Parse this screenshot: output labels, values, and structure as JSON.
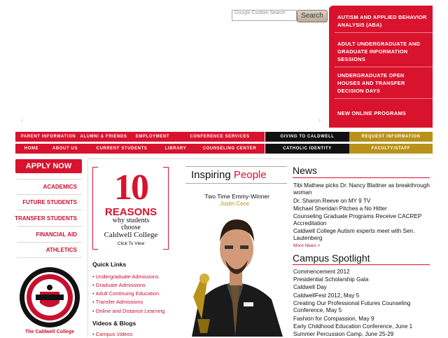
{
  "search": {
    "placeholder": "Custom Search",
    "brand": "Google",
    "button_label": "Search"
  },
  "promo": {
    "items": [
      "AUTISM AND APPLIED BEHAVIOR ANALYSIS (ABA)",
      "ADULT UNDERGRADUATE AND GRADUATE INFORMATION SESSIONS",
      "UNDERGRADUATE OPEN HOUSES AND TRANSFER DECISION DAYS",
      "NEW ONLINE PROGRAMS"
    ]
  },
  "nav_top": [
    "PARENT INFORMATION",
    "ALUMNI & FRIENDS",
    "EMPLOYMENT",
    "CONFERENCE SERVICES",
    "GIVING TO CALDWELL",
    "REQUEST INFORMATION"
  ],
  "nav_bottom": [
    "HOME",
    "ABOUT US",
    "CURRENT STUDENTS",
    "LIBRARY",
    "COUNSELING CENTER",
    "CATHOLIC IDENTITY",
    "FACULTY/STAFF"
  ],
  "sidebar": {
    "apply_label": "APPLY NOW",
    "links": [
      "ACADEMICS",
      "FUTURE STUDENTS",
      "TRANSFER STUDENTS",
      "FINANCIAL AID",
      "ATHLETICS"
    ],
    "seal_caption": "The Caldwell College"
  },
  "reasons": {
    "number": "10",
    "word": "REASONS",
    "line1": "why students",
    "line2": "choose",
    "line3": "Caldwell College",
    "cta": "Click To View"
  },
  "quick_links": {
    "heading": "Quick Links",
    "items": [
      "Undergraduate Admissions",
      "Graduate Admissions",
      "Adult Continuing Education",
      "Transfer Admissions",
      "Online and Distance Learning"
    ]
  },
  "videos": {
    "heading": "Videos & Blogs",
    "items": [
      "Campus Videos"
    ]
  },
  "feature": {
    "title_a": "Inspiring ",
    "title_b": "People",
    "caption": "Two Time Emmy-Winner",
    "person": "Justin Cece"
  },
  "news": {
    "heading": "News",
    "items": [
      "Tibi Mathew picks Dr. Nancy Blattner as breakthrough woman",
      "Dr. Sharon Reeve on MY 9 TV",
      "Michael Sheridan Pitches a No Hitter",
      "Counseling Graduate Programs Receive CACREP Accreditation",
      "Caldwell College Autism experts meet with Sen. Lautenberg"
    ],
    "more": "More News >"
  },
  "spotlight": {
    "heading": "Campus Spotlight",
    "items": [
      "Commencement 2012",
      "Presidential Scholarship Gala",
      "Caldwell Day",
      "CaldwellFest 2012, May 5",
      "Creating Our Professional Futures Counseling Conference, May 5",
      "Fashion for Compassion, May 9",
      "Early Childhood Education Conference, June 1",
      "Summer Percussion Camp, June 25-29"
    ]
  },
  "colors": {
    "red": "#d9122e",
    "black": "#111111",
    "gold": "#b8921a"
  }
}
